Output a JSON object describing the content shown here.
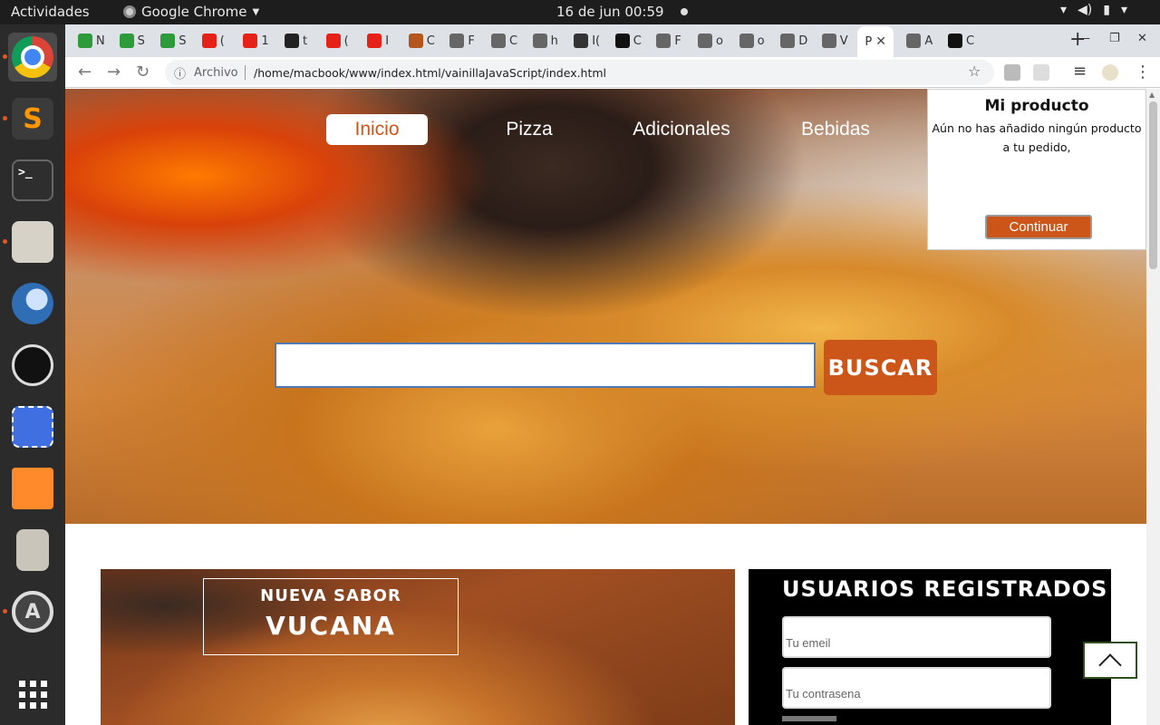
{
  "system_bar": {
    "activities": "Actividades",
    "app_name": "Google Chrome",
    "clock": "16 de jun 00:59"
  },
  "dock": {
    "apps": [
      "chrome-icon",
      "sublime-text-icon",
      "terminal-icon",
      "files-icon",
      "thunderbird-icon",
      "obs-icon",
      "screenshot-icon",
      "impress-icon",
      "archive-icon",
      "software-icon",
      "app-grid-icon"
    ]
  },
  "browser": {
    "tabs": [
      {
        "label": "N"
      },
      {
        "label": "S"
      },
      {
        "label": "S"
      },
      {
        "label": "("
      },
      {
        "label": "1"
      },
      {
        "label": "t"
      },
      {
        "label": "("
      },
      {
        "label": "I"
      },
      {
        "label": "C"
      },
      {
        "label": "F"
      },
      {
        "label": "C"
      },
      {
        "label": "h"
      },
      {
        "label": "I("
      },
      {
        "label": "C"
      },
      {
        "label": "F"
      },
      {
        "label": "o"
      },
      {
        "label": "o"
      },
      {
        "label": "D"
      },
      {
        "label": "V"
      },
      {
        "label": "P",
        "active": true
      },
      {
        "label": "A"
      },
      {
        "label": "C"
      }
    ],
    "address": {
      "scheme_label": "Archivo",
      "url": "/home/macbook/www/index.html/vainillaJavaScript/index.html"
    }
  },
  "site": {
    "nav": [
      "Inicio",
      "Pizza",
      "Adicionales",
      "Bebidas"
    ],
    "nav_active": "Inicio",
    "search": {
      "value": "",
      "button": "BUSCAR"
    },
    "cart": {
      "title": "Mi producto",
      "message": "Aún no has añadido ningún producto a tu pedido,",
      "button": "Continuar"
    },
    "promo": {
      "subtitle": "NUEVA SABOR",
      "title": "VUCANA"
    },
    "users": {
      "title": "USUARIOS REGISTRADOS",
      "email_placeholder": "Tu emeil",
      "password_placeholder": "Tu contrasena"
    }
  },
  "colors": {
    "accent": "#cc5519",
    "panel_bg": "#000000"
  }
}
